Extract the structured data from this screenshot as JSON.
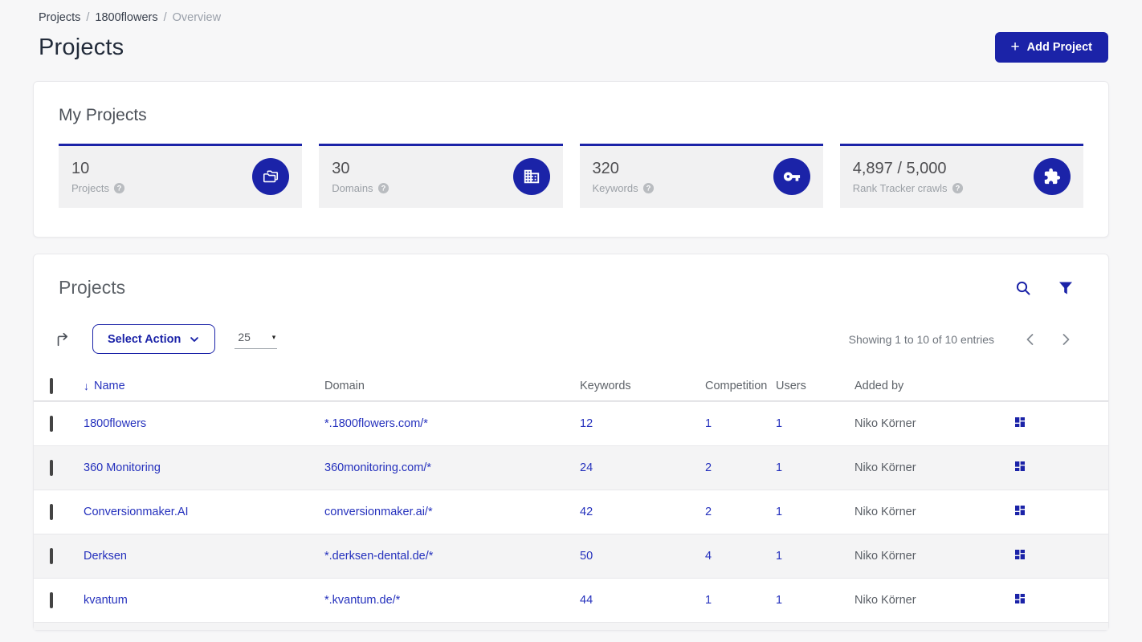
{
  "breadcrumb": {
    "items": [
      "Projects",
      "1800flowers",
      "Overview"
    ],
    "sep1": "/",
    "sep2": "/"
  },
  "page": {
    "title": "Projects"
  },
  "header": {
    "add_project_label": "Add Project",
    "plus": "+"
  },
  "stats_card": {
    "title": "My Projects",
    "tiles": [
      {
        "value": "10",
        "label": "Projects"
      },
      {
        "value": "30",
        "label": "Domains"
      },
      {
        "value": "320",
        "label": "Keywords"
      },
      {
        "value": "4,897 / 5,000",
        "label": "Rank Tracker crawls"
      }
    ]
  },
  "projects_card": {
    "title": "Projects",
    "toolbar": {
      "select_action_label": "Select Action",
      "page_size": "25",
      "page_size_caret": "▾",
      "showing_text": "Showing 1 to 10 of 10 entries"
    },
    "table": {
      "sort_arrow": "↓",
      "columns": {
        "name": "Name",
        "domain": "Domain",
        "keywords": "Keywords",
        "competition": "Competition",
        "users": "Users",
        "added_by": "Added by"
      },
      "rows": [
        {
          "name": "1800flowers",
          "domain": "*.1800flowers.com/*",
          "keywords": "12",
          "competition": "1",
          "users": "1",
          "added_by": "Niko Körner"
        },
        {
          "name": "360 Monitoring",
          "domain": "360monitoring.com/*",
          "keywords": "24",
          "competition": "2",
          "users": "1",
          "added_by": "Niko Körner"
        },
        {
          "name": "Conversionmaker.AI",
          "domain": "conversionmaker.ai/*",
          "keywords": "42",
          "competition": "2",
          "users": "1",
          "added_by": "Niko Körner"
        },
        {
          "name": "Derksen",
          "domain": "*.derksen-dental.de/*",
          "keywords": "50",
          "competition": "4",
          "users": "1",
          "added_by": "Niko Körner"
        },
        {
          "name": "kvantum",
          "domain": "*.kvantum.de/*",
          "keywords": "44",
          "competition": "1",
          "users": "1",
          "added_by": "Niko Körner"
        }
      ]
    }
  },
  "colors": {
    "primary": "#1b23a8",
    "link": "#2531bd"
  }
}
